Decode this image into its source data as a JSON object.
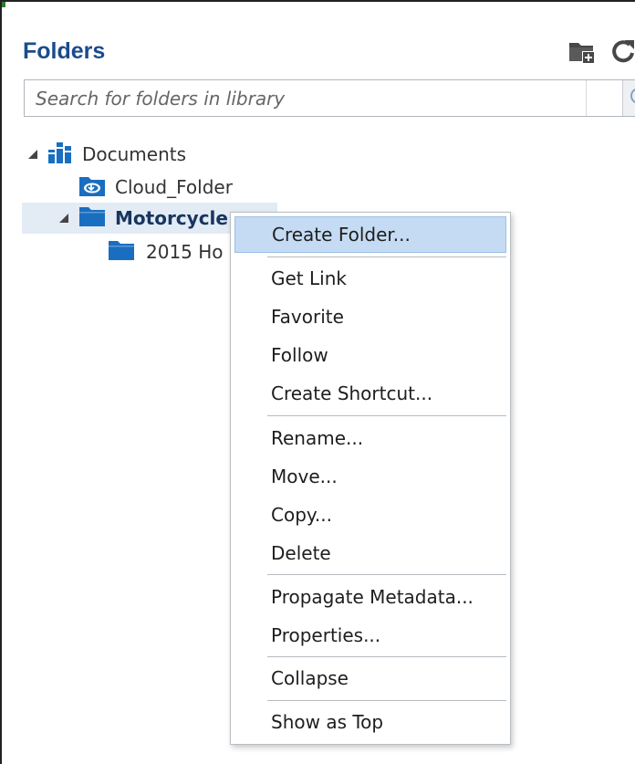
{
  "panel": {
    "title": "Folders",
    "icons": [
      "new-folder-icon",
      "refresh-icon"
    ]
  },
  "search": {
    "placeholder": "Search for folders in library",
    "value": ""
  },
  "tree": {
    "items": [
      {
        "label": "Documents",
        "icon": "library-icon",
        "expanded": true
      },
      {
        "label": "Cloud_Folder",
        "icon": "cloud-folder-icon"
      },
      {
        "label": "Motorcycle",
        "icon": "folder-icon",
        "expanded": true,
        "selected": true
      },
      {
        "label": "2015 Ho",
        "icon": "folder-icon"
      }
    ]
  },
  "context_menu": {
    "items": [
      {
        "label": "Create Folder...",
        "highlighted": true
      },
      {
        "label": "Get Link"
      },
      {
        "label": "Favorite"
      },
      {
        "label": "Follow"
      },
      {
        "label": "Create Shortcut..."
      },
      {
        "label": "Rename..."
      },
      {
        "label": "Move..."
      },
      {
        "label": "Copy..."
      },
      {
        "label": "Delete"
      },
      {
        "label": "Propagate Metadata..."
      },
      {
        "label": "Properties..."
      },
      {
        "label": "Collapse"
      },
      {
        "label": "Show as Top"
      }
    ]
  },
  "colors": {
    "title": "#1a4b8c",
    "folder_icon": "#1a6ec0",
    "selected_row": "#e3ebf5",
    "menu_highlight": "#c5dbf3"
  }
}
